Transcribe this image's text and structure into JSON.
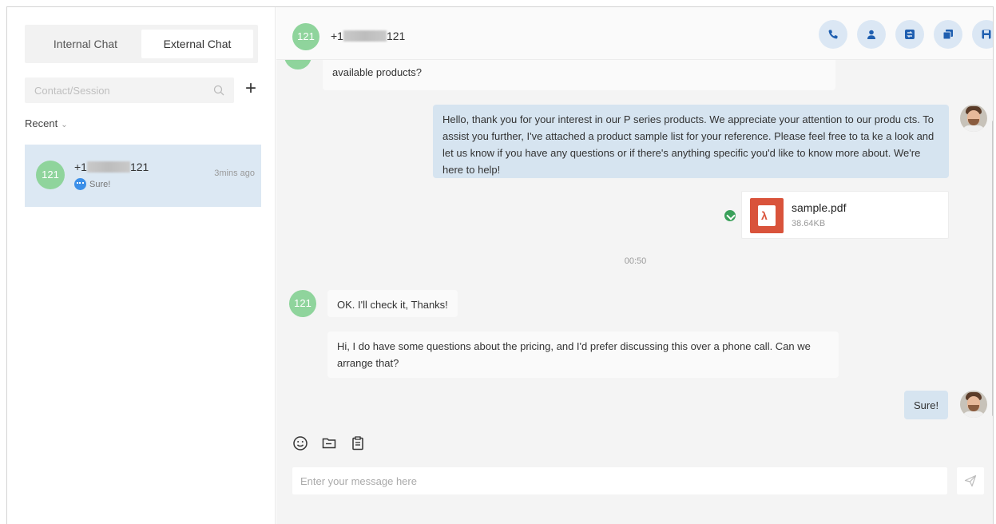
{
  "sidebar": {
    "tabs": [
      {
        "label": "Internal Chat",
        "active": false
      },
      {
        "label": "External Chat",
        "active": true
      }
    ],
    "search": {
      "placeholder": "Contact/Session",
      "value": ""
    },
    "add_label": "+",
    "recent_label": "Recent",
    "sessions": [
      {
        "avatar_text": "121",
        "number_prefix": "+1",
        "number_suffix": "121",
        "time": "3mins ago",
        "last_message": "Sure!",
        "selected": true
      }
    ]
  },
  "header": {
    "avatar_text": "121",
    "number_prefix": "+1",
    "number_suffix": "121",
    "actions": [
      "phone-icon",
      "user-icon",
      "transfer-icon",
      "copy-icon",
      "save-icon"
    ]
  },
  "messages": {
    "partial_in": "available products?",
    "out_1": "Hello, thank you for your interest in our P series products. We appreciate your attention to our produ cts. To assist you further, I've attached a product sample list for your reference. Please feel free to ta ke a look and let us know if you have any questions or if there's anything specific you'd like to know more about. We're here to help!",
    "file": {
      "name": "sample.pdf",
      "size": "38.64KB"
    },
    "timestamp": "00:50",
    "contact_avatar_text": "121",
    "in_1": "OK. I'll check it, Thanks!",
    "in_2": "Hi, I do have some questions about the pricing, and I'd prefer discussing this over a phone call. Can we arrange that?",
    "out_2": "Sure!"
  },
  "composer": {
    "placeholder": "Enter your message here",
    "value": "",
    "tools": [
      "emoji-icon",
      "folder-icon",
      "quick-reply-icon"
    ]
  },
  "colors": {
    "accent_bubble": "#d6e4f0",
    "avatar_green": "#8fd49c",
    "pdf_red": "#d9533b",
    "header_button": "#dbe7f4"
  }
}
